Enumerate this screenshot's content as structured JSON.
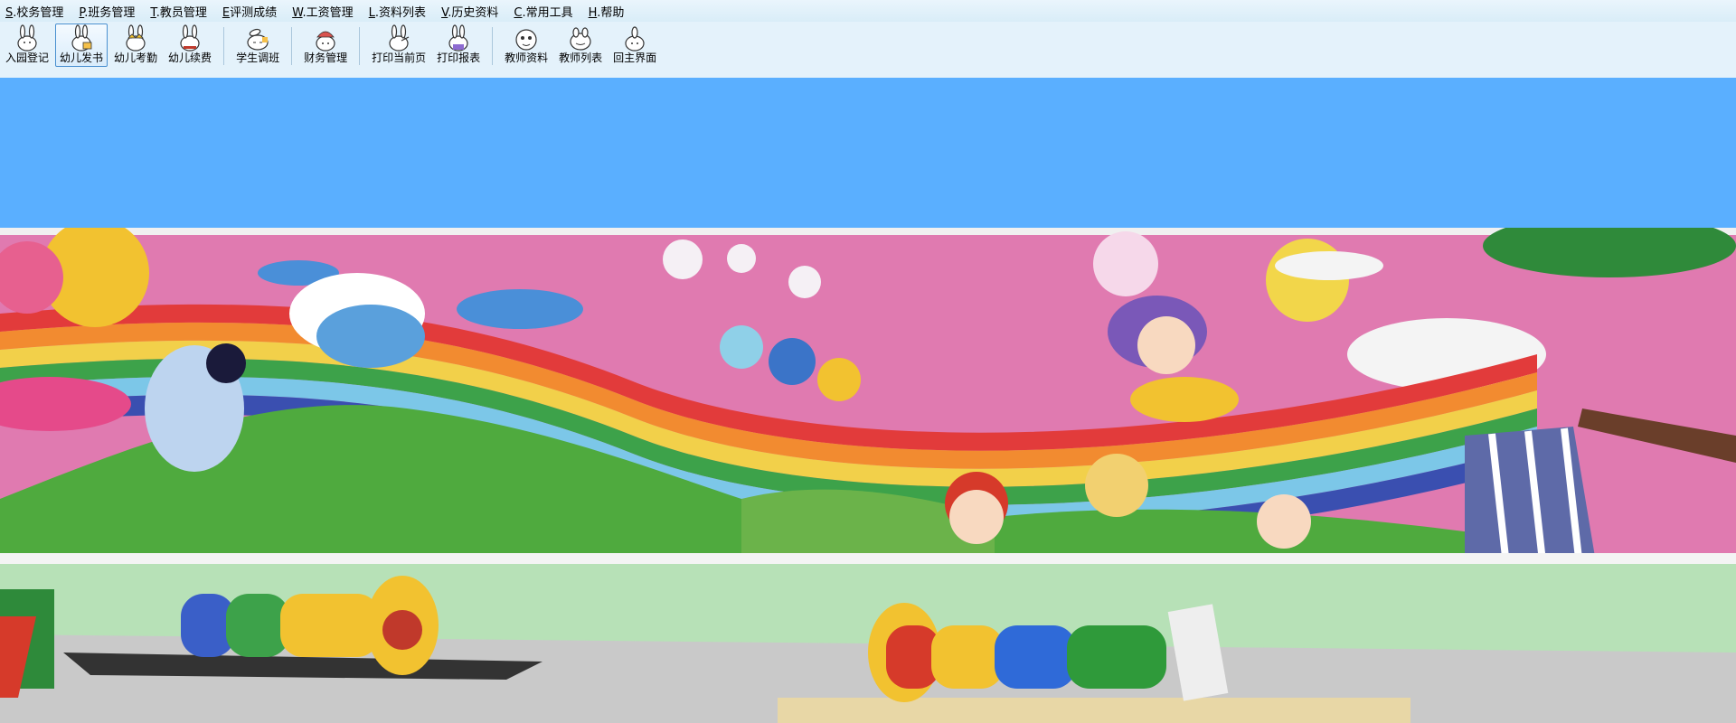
{
  "menu": [
    {
      "key": "S",
      "label": ".校务管理"
    },
    {
      "key": "P",
      "label": ".班务管理"
    },
    {
      "key": "T",
      "label": ".教员管理"
    },
    {
      "key": "E",
      "label": "评测成绩"
    },
    {
      "key": "W",
      "label": ".工资管理"
    },
    {
      "key": "L",
      "label": ".资料列表"
    },
    {
      "key": "V",
      "label": ".历史资料"
    },
    {
      "key": "C",
      "label": ".常用工具"
    },
    {
      "key": "H",
      "label": ".帮助"
    }
  ],
  "toolbar": {
    "enroll": "入园登记",
    "issue_books": "幼儿发书",
    "attendance": "幼儿考勤",
    "renew_fee": "幼儿续费",
    "transfer_class": "学生调班",
    "finance": "财务管理",
    "print_page": "打印当前页",
    "print_report": "打印报表",
    "teacher_info": "教师资料",
    "teacher_list": "教师列表",
    "home": "回主界面"
  },
  "colors": {
    "desktop_blue": "#5aafff",
    "toolbar_bg": "#e4f2fb",
    "wall_pink": "#e07ab0"
  }
}
